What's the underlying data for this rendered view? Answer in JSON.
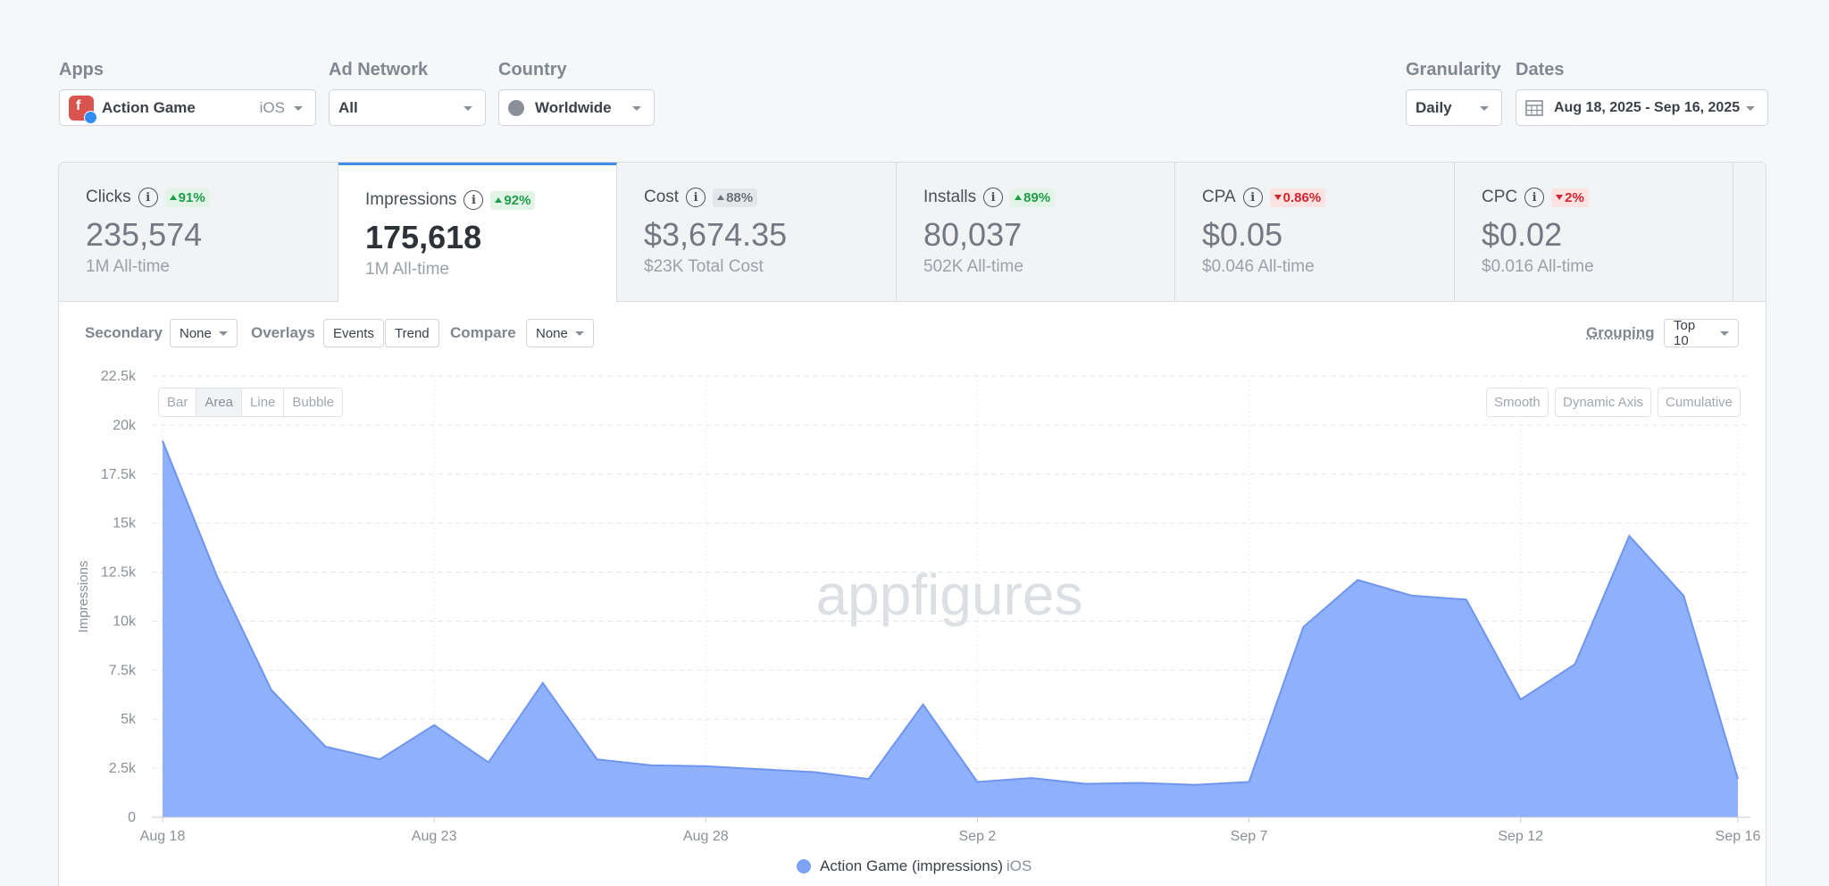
{
  "filters": {
    "apps_label": "Apps",
    "app_name": "Action Game",
    "app_platform": "iOS",
    "ad_network_label": "Ad Network",
    "ad_network_value": "All",
    "country_label": "Country",
    "country_value": "Worldwide",
    "granularity_label": "Granularity",
    "granularity_value": "Daily",
    "dates_label": "Dates",
    "dates_value": "Aug 18, 2025 - Sep 16, 2025"
  },
  "metrics": [
    {
      "name": "Clicks",
      "change": "91%",
      "direction": "up",
      "value": "235,574",
      "sub": "1M All-time"
    },
    {
      "name": "Impressions",
      "change": "92%",
      "direction": "up",
      "value": "175,618",
      "sub": "1M All-time"
    },
    {
      "name": "Cost",
      "change": "88%",
      "direction": "neutral",
      "value": "$3,674.35",
      "sub": "$23K Total Cost"
    },
    {
      "name": "Installs",
      "change": "89%",
      "direction": "up",
      "value": "80,037",
      "sub": "502K All-time"
    },
    {
      "name": "CPA",
      "change": "0.86%",
      "direction": "down",
      "value": "$0.05",
      "sub": "$0.046 All-time"
    },
    {
      "name": "CPC",
      "change": "2%",
      "direction": "down",
      "value": "$0.02",
      "sub": "$0.016 All-time"
    }
  ],
  "controls": {
    "secondary_label": "Secondary",
    "secondary_value": "None",
    "overlays_label": "Overlays",
    "events_label": "Events",
    "trend_label": "Trend",
    "compare_label": "Compare",
    "compare_value": "None",
    "grouping_label": "Grouping",
    "grouping_value": "Top 10",
    "chart_types": [
      "Bar",
      "Area",
      "Line",
      "Bubble"
    ],
    "active_chart_type": "Area",
    "smooth_label": "Smooth",
    "dynamic_axis_label": "Dynamic Axis",
    "cumulative_label": "Cumulative"
  },
  "watermark": "appfigures",
  "colors": {
    "area_fill": "#8fb0fb",
    "area_line": "#6f95ee",
    "active_tab_border": "#3d8ee8",
    "delta_up": "#1f9d4a",
    "delta_down": "#d1242f"
  },
  "chart_data": {
    "type": "area",
    "ylabel": "Impressions",
    "ylim": [
      0,
      22500
    ],
    "yticks": [
      0,
      2500,
      5000,
      7500,
      10000,
      12500,
      15000,
      17500,
      20000,
      22500
    ],
    "ytick_labels": [
      "0",
      "2.5k",
      "5k",
      "7.5k",
      "10k",
      "12.5k",
      "15k",
      "17.5k",
      "20k",
      "22.5k"
    ],
    "xtick_labels": [
      "Aug 18",
      "Aug 23",
      "Aug 28",
      "Sep 2",
      "Sep 7",
      "Sep 12",
      "Sep 16"
    ],
    "xtick_dates": [
      "2025-08-18",
      "2025-08-23",
      "2025-08-28",
      "2025-09-02",
      "2025-09-07",
      "2025-09-12",
      "2025-09-16"
    ],
    "grid": true,
    "x": [
      "2025-08-18",
      "2025-08-19",
      "2025-08-20",
      "2025-08-21",
      "2025-08-22",
      "2025-08-23",
      "2025-08-24",
      "2025-08-25",
      "2025-08-26",
      "2025-08-27",
      "2025-08-28",
      "2025-08-29",
      "2025-08-30",
      "2025-08-31",
      "2025-09-01",
      "2025-09-02",
      "2025-09-03",
      "2025-09-04",
      "2025-09-05",
      "2025-09-06",
      "2025-09-07",
      "2025-09-08",
      "2025-09-09",
      "2025-09-10",
      "2025-09-11",
      "2025-09-12",
      "2025-09-13",
      "2025-09-14",
      "2025-09-15",
      "2025-09-16"
    ],
    "series": [
      {
        "name": "Action Game (impressions)",
        "tag": "iOS",
        "values": [
          19200,
          12300,
          6500,
          3600,
          2950,
          4700,
          2800,
          6850,
          2950,
          2650,
          2600,
          2450,
          2300,
          1950,
          5750,
          1800,
          2000,
          1700,
          1750,
          1650,
          1800,
          9700,
          12100,
          11300,
          11100,
          6000,
          7800,
          14350,
          11300,
          1950
        ]
      }
    ]
  }
}
